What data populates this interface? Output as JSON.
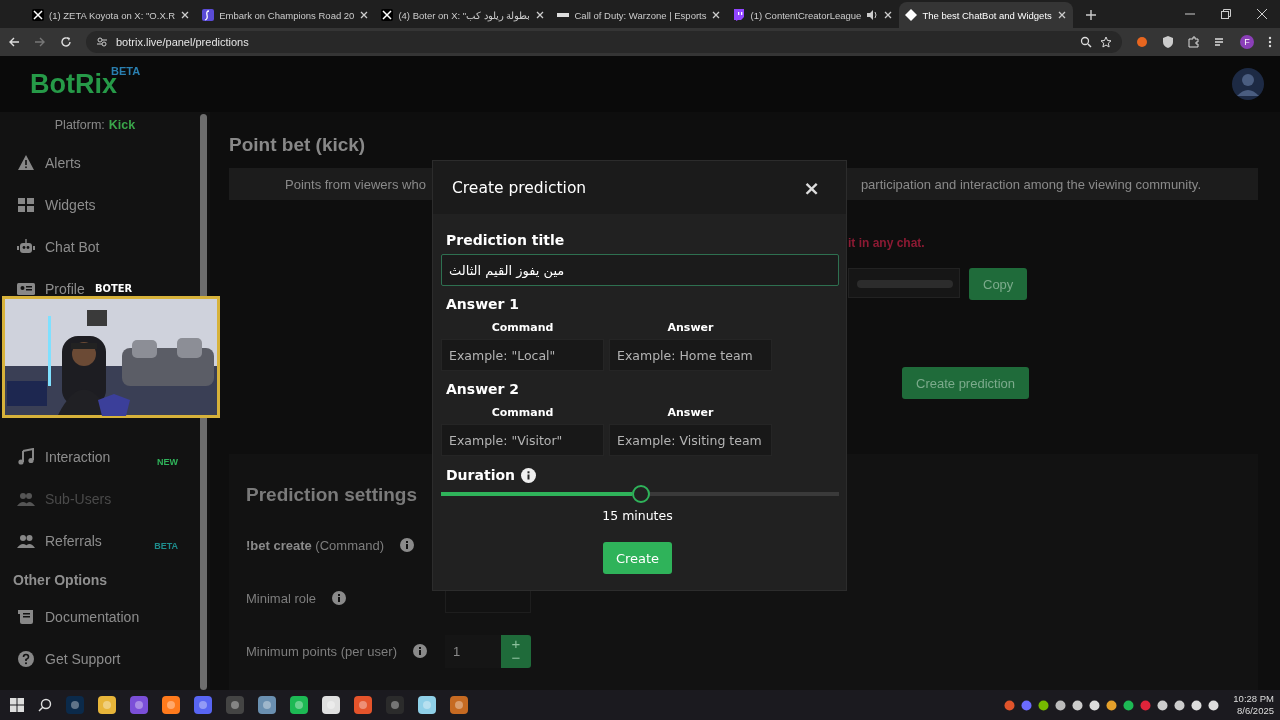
{
  "browser": {
    "tabs": [
      {
        "title": "(1) ZETA Koyota on X: \"O.X.R",
        "selected": false,
        "audio": false
      },
      {
        "title": "Embark on Champions Road 20",
        "selected": false,
        "audio": false
      },
      {
        "title": "(4) Boter on X: \"بطولة ريلود كب",
        "selected": false,
        "audio": false
      },
      {
        "title": "Call of Duty: Warzone | Esports",
        "selected": false,
        "audio": false
      },
      {
        "title": "(1) ContentCreatorLeague",
        "selected": false,
        "audio": true
      },
      {
        "title": "The best ChatBot and Widgets",
        "selected": true,
        "audio": false
      }
    ],
    "address": "botrix.live/panel/predictions",
    "profile_initial": "F"
  },
  "header": {
    "logo": "BotRix",
    "logo_badge": "BETA"
  },
  "sidebar": {
    "platform_label": "Platform:",
    "platform": "Kick",
    "items": [
      {
        "label": "Alerts",
        "disabled": false
      },
      {
        "label": "Widgets",
        "disabled": false
      },
      {
        "label": "Chat Bot",
        "disabled": false
      },
      {
        "label": "Profile",
        "disabled": false
      },
      {
        "label": "Interaction",
        "disabled": false,
        "badge": {
          "text": "NEW",
          "color": "#2fb35a"
        }
      },
      {
        "label": "Sub-Users",
        "disabled": true
      },
      {
        "label": "Referrals",
        "disabled": false,
        "badge": {
          "text": "BETA",
          "color": "#1e8c8c"
        }
      }
    ],
    "section": "Other Options",
    "other_items": [
      {
        "label": "Documentation"
      },
      {
        "label": "Get Support"
      }
    ]
  },
  "webcam": {
    "label": "BOTER",
    "kind": "picture"
  },
  "main": {
    "title": "Point bet (kick)",
    "description_start": "Points from viewers who",
    "description_end": "participation and interaction among the viewing community.",
    "warning": "it in any chat.",
    "copy_button": "Copy",
    "create_button": "Create prediction",
    "settings": {
      "title": "Prediction settings",
      "rows": [
        {
          "label": "**!bet create** (Command)"
        },
        {
          "label": "Minimal role"
        },
        {
          "label": "Minimum points (per user)",
          "value": "1",
          "stepper": [
            "+",
            "−"
          ]
        }
      ]
    }
  },
  "modal": {
    "title": "Create prediction",
    "close": "×",
    "title_label": "Prediction title",
    "title_value": "مين يفوز القيم الثالث",
    "answers": [
      {
        "heading": "Answer 1",
        "command_label": "Command",
        "answer_label": "Answer",
        "command_placeholder": "Example: \"Local\"",
        "answer_placeholder": "Example: Home team"
      },
      {
        "heading": "Answer 2",
        "command_label": "Command",
        "answer_label": "Answer",
        "command_placeholder": "Example: \"Visitor\"",
        "answer_placeholder": "Example: Visiting team"
      }
    ],
    "duration": {
      "label": "Duration",
      "level": 0.48,
      "reading": "15 minutes"
    },
    "submit": "Create"
  },
  "taskbar": {
    "time": "10:28 PM",
    "date": "8/6/2025"
  }
}
